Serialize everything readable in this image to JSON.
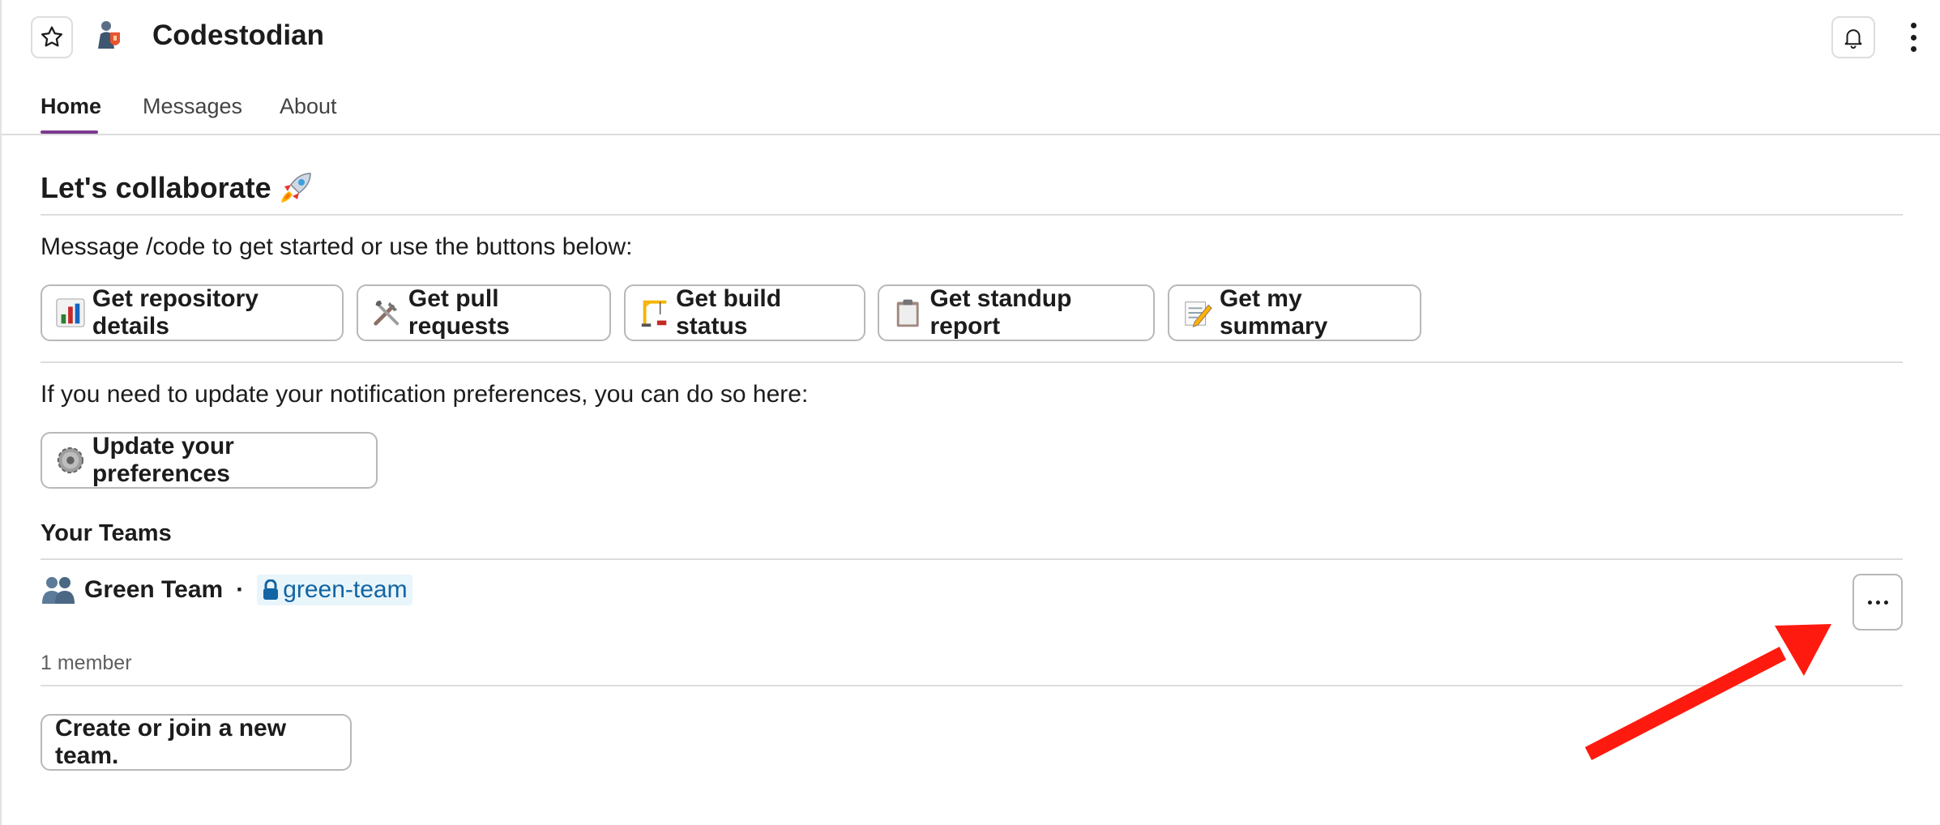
{
  "header": {
    "app_name": "Codestodian"
  },
  "tabs": [
    {
      "label": "Home",
      "active": true
    },
    {
      "label": "Messages",
      "active": false
    },
    {
      "label": "About",
      "active": false
    }
  ],
  "home": {
    "title": "Let's collaborate",
    "intro": "Message /code to get started or use the buttons below:",
    "actions": [
      {
        "label": "Get repository details",
        "icon": "bar-chart-icon"
      },
      {
        "label": "Get pull requests",
        "icon": "tools-icon"
      },
      {
        "label": "Get build status",
        "icon": "crane-icon"
      },
      {
        "label": "Get standup report",
        "icon": "clipboard-icon"
      },
      {
        "label": "Get my summary",
        "icon": "memo-icon"
      }
    ],
    "prefs_text": "If you need to update your notification preferences, you can do so here:",
    "prefs_button": "Update your preferences",
    "teams_heading": "Your Teams",
    "team": {
      "name": "Green Team",
      "separator": "·",
      "channel": "green-team",
      "members": "1 member"
    },
    "create_team_button": "Create or join a new team."
  },
  "colors": {
    "tab_accent": "#7c3a8e",
    "channel_link": "#1264a3",
    "channel_bg": "#e8f5fa",
    "annotation_arrow": "#ff1a0f"
  }
}
